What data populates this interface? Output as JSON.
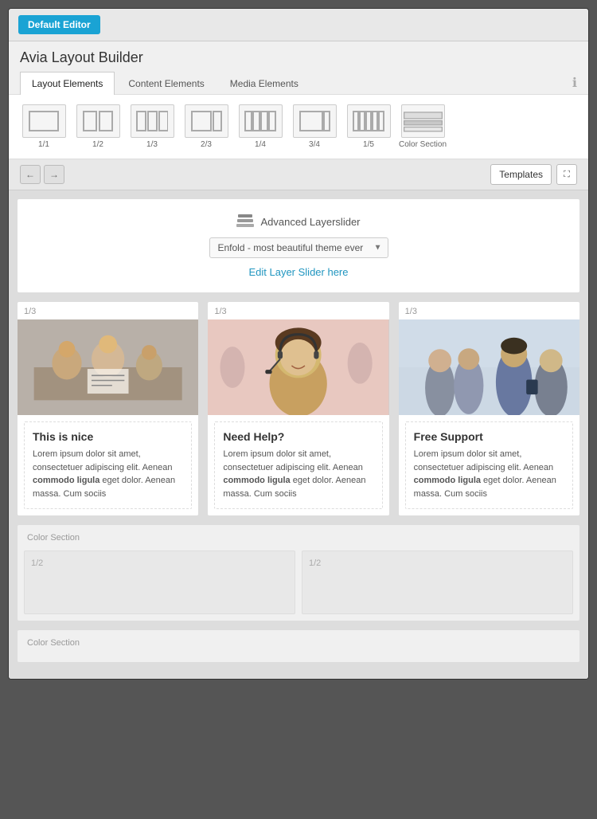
{
  "topbar": {
    "default_editor_label": "Default Editor"
  },
  "builder": {
    "title": "Avia Layout Builder"
  },
  "tabs": {
    "active": "Layout Elements",
    "items": [
      "Layout Elements",
      "Content Elements",
      "Media Elements"
    ]
  },
  "elements": [
    {
      "label": "1/1",
      "type": "1col"
    },
    {
      "label": "1/2",
      "type": "2col"
    },
    {
      "label": "1/3",
      "type": "3col"
    },
    {
      "label": "2/3",
      "type": "2_3col"
    },
    {
      "label": "1/4",
      "type": "4col"
    },
    {
      "label": "3/4",
      "type": "3_4col"
    },
    {
      "label": "1/5",
      "type": "5col"
    },
    {
      "label": "Color Section",
      "type": "color"
    }
  ],
  "toolbar": {
    "templates_label": "Templates",
    "undo_title": "Undo",
    "redo_title": "Redo",
    "expand_title": "Expand"
  },
  "layerslider": {
    "title": "Advanced Layerslider",
    "dropdown_value": "Enfold - most beautiful theme ever",
    "edit_link": "Edit Layer Slider here",
    "dropdown_options": [
      "Enfold - most beautiful theme ever"
    ]
  },
  "columns": [
    {
      "label": "1/3",
      "image_alt": "Business meeting photo",
      "text_title": "This is nice",
      "text_body_plain": "Lorem ipsum dolor sit amet, consectetuer adipiscing elit. Aenean ",
      "text_body_bold": "commodo ligula",
      "text_body_plain2": " eget dolor. Aenean massa. Cum sociis"
    },
    {
      "label": "1/3",
      "image_alt": "Customer support woman photo",
      "text_title": "Need Help?",
      "text_body_plain": "Lorem ipsum dolor sit amet, consectetuer adipiscing elit. Aenean ",
      "text_body_bold": "commodo ligula",
      "text_body_plain2": " eget dolor. Aenean massa. Cum sociis"
    },
    {
      "label": "1/3",
      "image_alt": "Business team photo",
      "text_title": "Free Support",
      "text_body_plain": "Lorem ipsum dolor sit amet, consectetuer adipiscing elit. Aenean ",
      "text_body_bold": "commodo ligula",
      "text_body_plain2": " eget dolor. Aenean massa. Cum sociis"
    }
  ],
  "color_sections": [
    {
      "label": "Color Section",
      "cols": [
        {
          "label": "1/2"
        },
        {
          "label": "1/2"
        }
      ]
    },
    {
      "label": "Color Section",
      "cols": []
    }
  ],
  "info_icon": "ℹ"
}
